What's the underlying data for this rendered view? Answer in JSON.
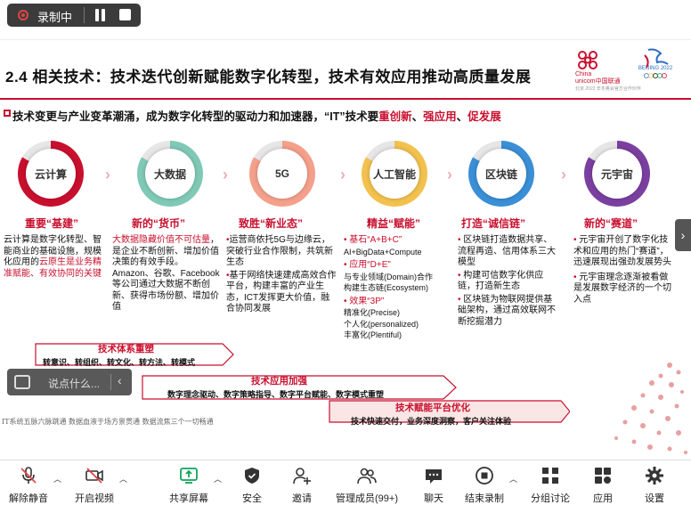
{
  "recording": {
    "label": "录制中"
  },
  "slide": {
    "title": "2.4 相关技术：技术迭代创新赋能数字化转型，技术有效应用推动高质量发展",
    "logo": {
      "unicom_text_line1": "China",
      "unicom_text_line2": "unicom中国联通",
      "olympic_text": "BEIJING 2022",
      "caption": "北京 2022 年冬奥会官方合作伙伴"
    },
    "subtitle": {
      "prefix": "技术变更与产业变革潮涌，成为数字化转型的驱动力和加速器，“IT”技术要",
      "r1": "重创新",
      "sep1": "、",
      "r2": "强应用",
      "sep2": "、",
      "r3": "促发展"
    },
    "pillars": [
      {
        "name": "云计算",
        "color": "#c8102e",
        "head": "重要“基建”",
        "text_black": "云计算是数字化转型、智能商业的基础设施，规模化应用的",
        "text_red": "云原生是业务精准赋能、有效协同的关键"
      },
      {
        "name": "大数据",
        "color": "#7fc9b6",
        "head": "新的“货币”",
        "text_red": "大数据隐藏价值不可估量",
        "text_black": "，是企业不断创新、增加价值决策的有效手段。Amazon、谷歌、Facebook等公司通过大数据不断创新、获得市场份额、增加价值"
      },
      {
        "name": "5G",
        "color": "#f4a08a",
        "head": "致胜“新业态”",
        "bullets": [
          "运营商依托5G与边缘云，突破行业合作限制，共筑新生态",
          "基于网络快速建成高效合作平台，构建丰富的产业生态，ICT发挥更大价值，融合协同发展"
        ]
      },
      {
        "name": "人工智能",
        "color": "#f2c14e",
        "head": "精益“赋能”",
        "items": [
          {
            "red": "基石“A+B+C”",
            "black": "AI+BigData+Compute"
          },
          {
            "red": "应用“D+E”",
            "black": "与专业领域(Domain)合作\n构建生态链(Ecosystem)"
          },
          {
            "red": "效果“3P”",
            "black": "精准化(Precise)\n个人化(personalized)\n丰富化(Plentiful)"
          }
        ]
      },
      {
        "name": "区块链",
        "color": "#3a8fd6",
        "head": "打造“诚信链”",
        "bullets": [
          "区块链打造数据共享、流程再造、信用体系三大模型",
          "构建可信数字化供应链，打造新生态",
          "区块链为物联网提供基础架构，通过高效联网不断挖掘潜力"
        ]
      },
      {
        "name": "元宇宙",
        "color": "#7b3fa0",
        "head": "新的“赛道”",
        "bullets": [
          "元宇宙开创了数字化技术和应用的热门“赛道”，迅速展现出强劲发展势头",
          "元宇宙理念逐渐被看做是发展数字经济的一个切入点"
        ]
      }
    ],
    "bands": [
      {
        "title": "技术体系重塑",
        "text": "转意识、转组织、转文化、转方法、转模式"
      },
      {
        "title": "技术应用加强",
        "text": "数字理念驱动、数字策略指导、数字平台赋能、数字模式重塑"
      },
      {
        "title": "技术赋能平台优化",
        "text": "技术快速交付，业务深度洞察，客户关注体验"
      }
    ],
    "footer_note": "IT系统五脉六脉跳通  数据血液于场方景贯通  数据流焦三个一切畅通"
  },
  "caption_bar": {
    "placeholder": "说点什么..."
  },
  "toolbar": {
    "items": [
      {
        "label": "解除静音",
        "icon": "mic-off-icon"
      },
      {
        "label": "开启视频",
        "icon": "camera-off-icon"
      },
      {
        "label": "共享屏幕",
        "icon": "share-screen-icon"
      },
      {
        "label": "安全",
        "icon": "shield-icon"
      },
      {
        "label": "邀请",
        "icon": "invite-icon"
      },
      {
        "label": "管理成员(99+)",
        "icon": "members-icon"
      },
      {
        "label": "聊天",
        "icon": "chat-icon"
      },
      {
        "label": "结束录制",
        "icon": "stop-record-icon"
      },
      {
        "label": "分组讨论",
        "icon": "breakout-icon"
      },
      {
        "label": "应用",
        "icon": "apps-icon"
      },
      {
        "label": "设置",
        "icon": "gear-icon"
      }
    ],
    "accent": "#12a35a"
  }
}
